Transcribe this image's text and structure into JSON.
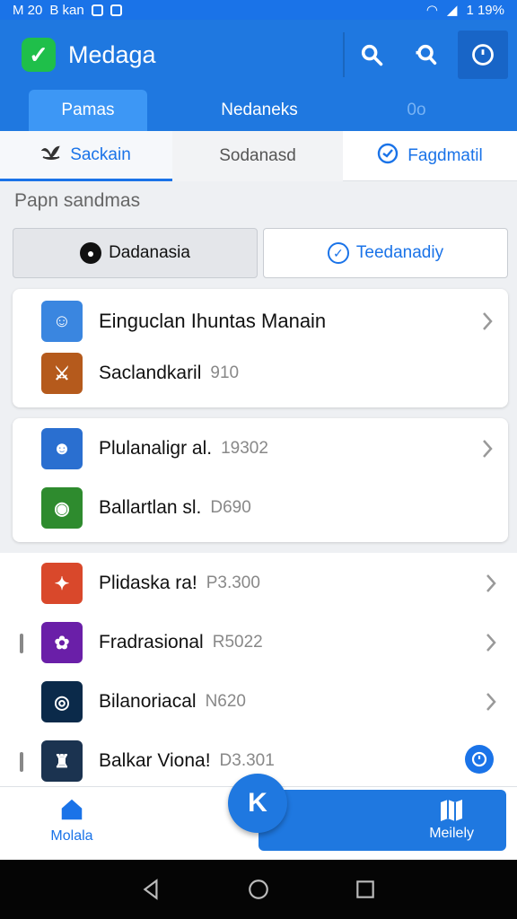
{
  "status_bar": {
    "time": "M 20",
    "carrier": "B kan",
    "battery": "1 19%"
  },
  "app_bar": {
    "title": "Medaga",
    "logo_glyph": "✓"
  },
  "top_tabs": [
    {
      "label": "Pamas"
    },
    {
      "label": "Nedaneks"
    },
    {
      "label": "0o"
    }
  ],
  "sub_tabs": [
    {
      "label": "Sackain"
    },
    {
      "label": "Sodanasd"
    },
    {
      "label": "Fagdmatil"
    }
  ],
  "section_title": "Papn sandmas",
  "segment": {
    "left": "Dadanasia",
    "right": "Teedanadiy"
  },
  "card1": {
    "rows": [
      {
        "title": "Einguclan Ihuntas Manain",
        "meta": "",
        "thumb_color": "#3a86e0",
        "thumb_glyph": "☺"
      },
      {
        "title": "Saclandkaril",
        "meta": "910",
        "thumb_color": "#b55a1c",
        "thumb_glyph": "⚔"
      }
    ]
  },
  "card2": {
    "rows": [
      {
        "title": "Plulanaligr al.",
        "meta": "19302",
        "thumb_color": "#2a6fd0",
        "thumb_glyph": "☻"
      },
      {
        "title": "Ballartlan sl.",
        "meta": "D690",
        "thumb_color": "#2e8b2e",
        "thumb_glyph": "◉"
      }
    ]
  },
  "list3": {
    "rows": [
      {
        "title": "Plidaska ra!",
        "meta": "P3.300",
        "thumb_color": "#d9482b",
        "thumb_glyph": "✦"
      },
      {
        "title": "Fradrasional",
        "meta": "R5022",
        "thumb_color": "#6a1fa8",
        "thumb_glyph": "✿"
      },
      {
        "title": "Bilanoriacal",
        "meta": "N620",
        "thumb_color": "#0b2a4a",
        "thumb_glyph": "◎"
      },
      {
        "title": "Balkar Viona!",
        "meta": "D3.301",
        "thumb_color": "#1b3350",
        "thumb_glyph": "♜"
      }
    ]
  },
  "bottom_nav": {
    "home_label": "Molala",
    "action_label": "Meilely",
    "fab_glyph": "K"
  },
  "colors": {
    "primary": "#1f78e0",
    "accent": "#1a73e8"
  }
}
